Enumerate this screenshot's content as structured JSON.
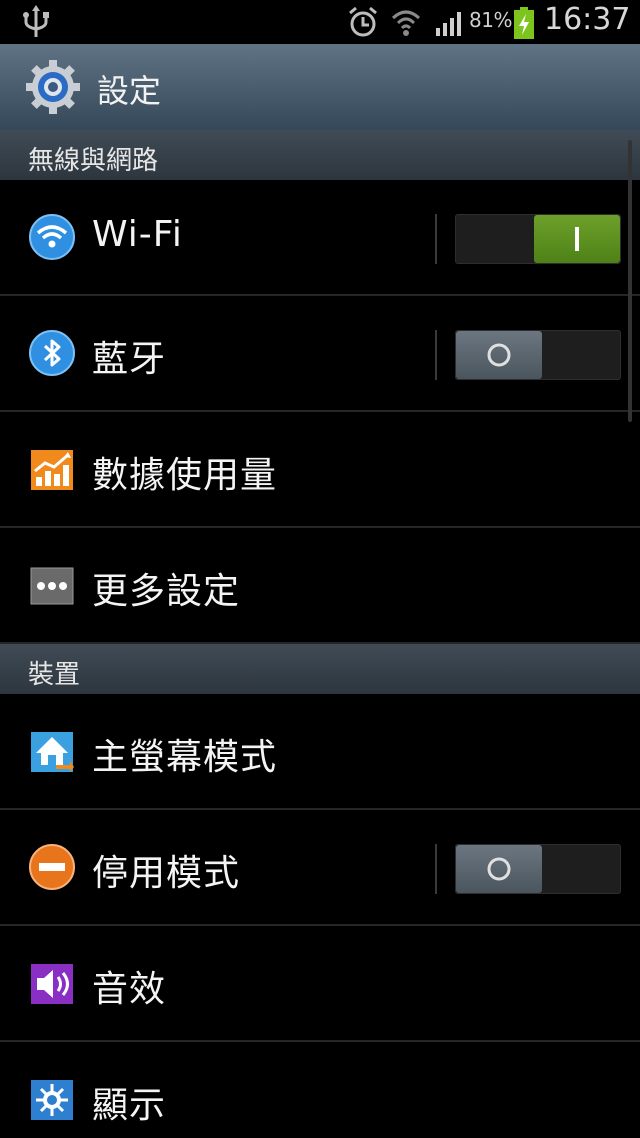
{
  "status_bar": {
    "battery_percent": "81%",
    "time": "16:37"
  },
  "title_bar": {
    "title": "設定"
  },
  "sections": [
    {
      "header": "無線與網路",
      "items": [
        {
          "label": "Wi-Fi",
          "icon": "wifi-icon",
          "toggle": "on"
        },
        {
          "label": "藍牙",
          "icon": "bluetooth-icon",
          "toggle": "off"
        },
        {
          "label": "數據使用量",
          "icon": "data-usage-icon"
        },
        {
          "label": "更多設定",
          "icon": "more-settings-icon"
        }
      ]
    },
    {
      "header": "裝置",
      "items": [
        {
          "label": "主螢幕模式",
          "icon": "home-screen-mode-icon"
        },
        {
          "label": "停用模式",
          "icon": "blocking-mode-icon",
          "toggle": "off"
        },
        {
          "label": "音效",
          "icon": "sound-icon"
        },
        {
          "label": "顯示",
          "icon": "display-icon"
        }
      ]
    }
  ],
  "colors": {
    "toggle_on": "#5a9020",
    "toggle_off": "#5c6770",
    "title_bar": "#4a5e70",
    "section_header": "#353f48"
  }
}
